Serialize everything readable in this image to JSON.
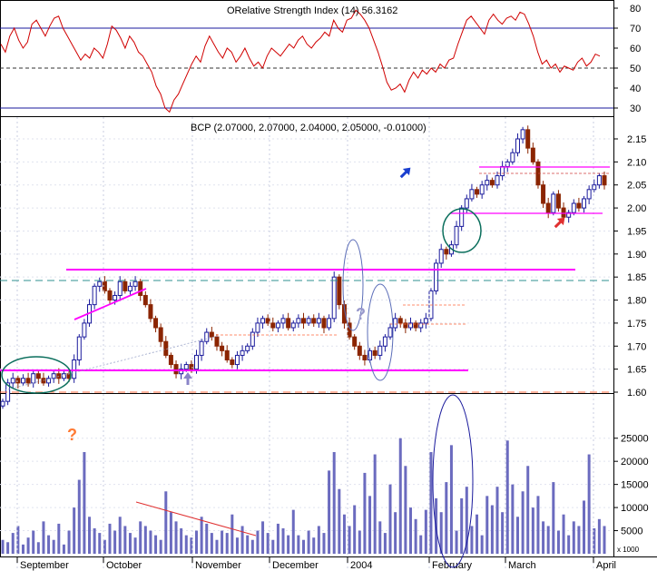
{
  "rsi_panel": {
    "title": "ORelative Strength Index (14) 56.3162",
    "y_ticks": [
      "80",
      "70",
      "60",
      "50",
      "40",
      "30"
    ],
    "line_color": "#d00000",
    "ref_lines": [
      70,
      50,
      30
    ]
  },
  "price_panel": {
    "title": "BCP (2.07000, 2.07000, 2.04000, 2.05000, -0.01000)",
    "y_ticks": [
      "2.15",
      "2.10",
      "2.05",
      "2.00",
      "1.95",
      "1.90",
      "1.85",
      "1.80",
      "1.75",
      "1.70",
      "1.65",
      "1.60"
    ],
    "up_color": "#1a1a9c",
    "down_color": "#8b2500",
    "annotation_colors": {
      "support_resistance": "#ff00ff",
      "ellipse_green": "#0a6e5c",
      "ellipse_blue": "#5b6db8",
      "dashed_orange": "#ff6a3d",
      "dashed_teal": "#2f8f8f"
    },
    "question_mark": "?",
    "arrows": [
      "up-arrow-blue",
      "up-arrow-red",
      "up-arrow-purple"
    ]
  },
  "volume_panel": {
    "y_ticks": [
      "25000",
      "20000",
      "15000",
      "10000",
      "5000"
    ],
    "scale_label": "x 1000",
    "question_mark": "?",
    "bar_color": "#6b6bbf"
  },
  "x_axis": {
    "months": [
      "September",
      "October",
      "November",
      "December",
      "2004",
      "February",
      "March",
      "April"
    ]
  },
  "chart_data": [
    {
      "type": "line",
      "title": "ORelative Strength Index (14) 56.3162",
      "ylim": [
        28,
        83
      ],
      "values": [
        62,
        58,
        66,
        70,
        64,
        60,
        63,
        72,
        74,
        70,
        66,
        71,
        75,
        76,
        70,
        66,
        62,
        58,
        54,
        57,
        55,
        60,
        58,
        55,
        62,
        71,
        69,
        65,
        60,
        66,
        63,
        58,
        56,
        52,
        48,
        41,
        37,
        30,
        28,
        34,
        37,
        42,
        47,
        52,
        56,
        53,
        61,
        66,
        62,
        58,
        55,
        60,
        58,
        53,
        56,
        60,
        55,
        51,
        53,
        50,
        56,
        60,
        58,
        56,
        59,
        62,
        60,
        64,
        66,
        62,
        60,
        63,
        65,
        68,
        66,
        74,
        70,
        68,
        74,
        75,
        79,
        77,
        74,
        70,
        64,
        58,
        51,
        43,
        39,
        40,
        42,
        38,
        44,
        48,
        45,
        49,
        47,
        50,
        48,
        52,
        50,
        54,
        55,
        62,
        68,
        74,
        76,
        73,
        70,
        67,
        74,
        77,
        74,
        72,
        75,
        76,
        74,
        78,
        77,
        72,
        66,
        58,
        52,
        54,
        50,
        52,
        48,
        51,
        50,
        49,
        53,
        55,
        51,
        53,
        57,
        56
      ]
    },
    {
      "type": "candlestick",
      "title": "BCP (2.07000, 2.07000, 2.04000, 2.05000, -0.01000)",
      "ylim": [
        1.58,
        2.17
      ],
      "x_categories": [
        "September",
        "October",
        "November",
        "December",
        "2004",
        "February",
        "March",
        "April"
      ],
      "closes": [
        1.58,
        1.62,
        1.63,
        1.62,
        1.63,
        1.62,
        1.64,
        1.63,
        1.62,
        1.63,
        1.64,
        1.63,
        1.64,
        1.63,
        1.67,
        1.72,
        1.75,
        1.79,
        1.83,
        1.84,
        1.82,
        1.8,
        1.81,
        1.84,
        1.82,
        1.83,
        1.84,
        1.81,
        1.79,
        1.76,
        1.74,
        1.71,
        1.68,
        1.66,
        1.64,
        1.65,
        1.66,
        1.65,
        1.68,
        1.71,
        1.73,
        1.72,
        1.7,
        1.69,
        1.67,
        1.66,
        1.68,
        1.69,
        1.7,
        1.73,
        1.75,
        1.76,
        1.75,
        1.74,
        1.75,
        1.76,
        1.74,
        1.75,
        1.76,
        1.75,
        1.76,
        1.75,
        1.76,
        1.74,
        1.76,
        1.85,
        1.79,
        1.75,
        1.72,
        1.7,
        1.68,
        1.67,
        1.69,
        1.68,
        1.7,
        1.72,
        1.74,
        1.76,
        1.75,
        1.74,
        1.75,
        1.74,
        1.75,
        1.76,
        1.82,
        1.88,
        1.91,
        1.9,
        1.92,
        1.96,
        2.0,
        2.02,
        2.04,
        2.03,
        2.05,
        2.06,
        2.05,
        2.07,
        2.09,
        2.1,
        2.12,
        2.15,
        2.17,
        2.13,
        2.1,
        2.05,
        2.01,
        1.99,
        2.03,
        2.0,
        1.98,
        1.99,
        2.01,
        2.0,
        2.02,
        2.04,
        2.05,
        2.07,
        2.05
      ]
    },
    {
      "type": "bar",
      "title": "",
      "ylabel": "x 1000",
      "ylim": [
        0,
        30000
      ],
      "values": [
        3000,
        2500,
        4500,
        6000,
        2000,
        3500,
        5000,
        2500,
        7000,
        4000,
        3000,
        6500,
        2000,
        5000,
        10000,
        16000,
        22000,
        8000,
        5500,
        4500,
        3000,
        6500,
        5000,
        8000,
        6000,
        4500,
        3500,
        7000,
        6000,
        5000,
        4000,
        3000,
        13500,
        9000,
        7000,
        5500,
        4000,
        3500,
        5000,
        8000,
        6500,
        4500,
        3000,
        5000,
        4500,
        8500,
        3500,
        6000,
        4000,
        3000,
        5000,
        7000,
        4500,
        3000,
        6500,
        5500,
        4000,
        9500,
        4000,
        3000,
        5000,
        3500,
        6000,
        4500,
        18000,
        22000,
        14000,
        8500,
        6000,
        10500,
        5000,
        17500,
        12500,
        21500,
        7000,
        4500,
        15000,
        9000,
        25000,
        19000,
        10000,
        7500,
        4000,
        9500,
        22000,
        12000,
        9000,
        15500,
        23500,
        5000,
        12000,
        14500,
        6000,
        8500,
        4000,
        12500,
        10500,
        14500,
        9000,
        24500,
        15000,
        8000,
        13500,
        19000,
        10000,
        12500,
        7000,
        6000,
        15500,
        5000,
        8500,
        4000,
        7000,
        6000,
        11500,
        21500,
        5500,
        7500,
        6000
      ]
    }
  ]
}
